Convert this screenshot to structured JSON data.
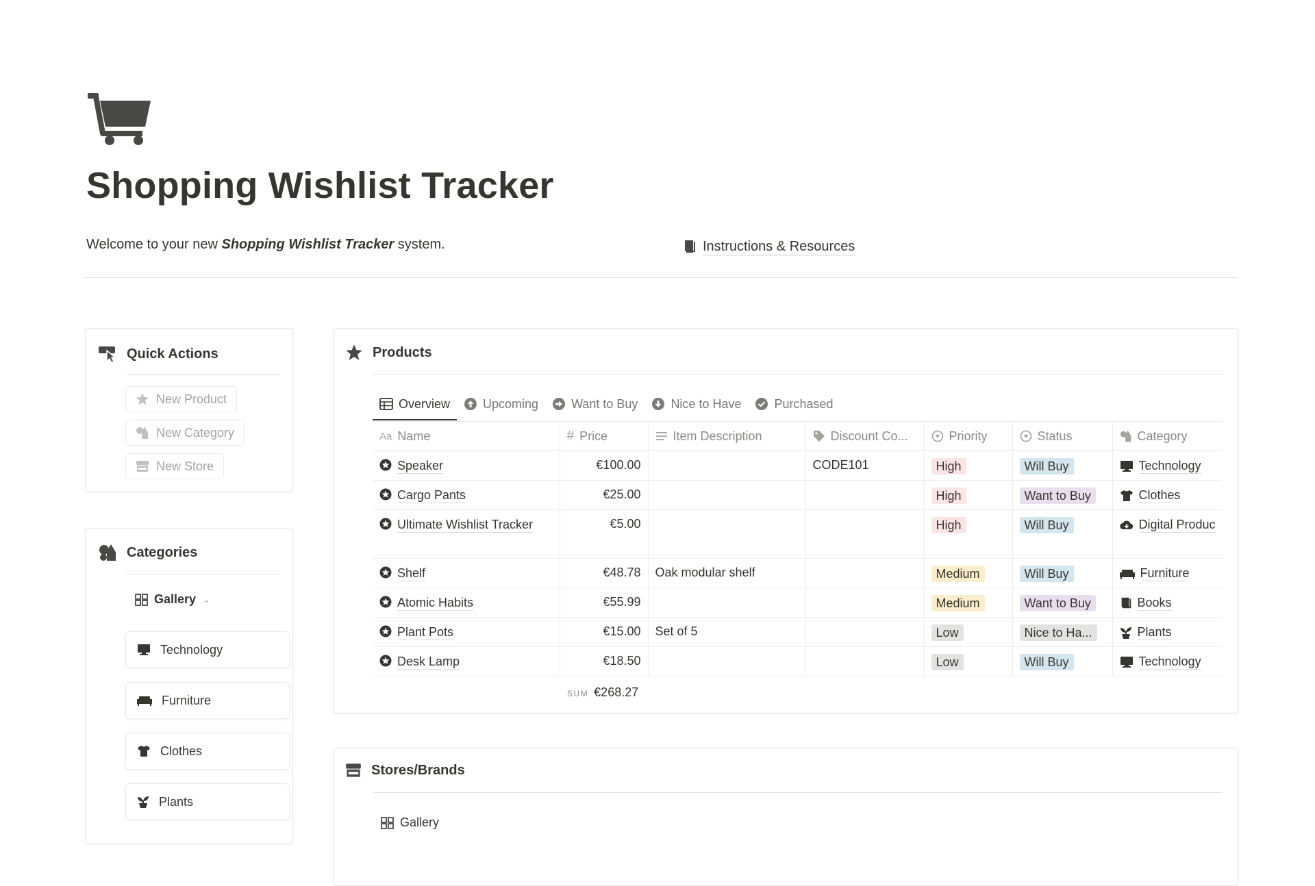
{
  "page": {
    "title": "Shopping Wishlist Tracker",
    "welcome_prefix": "Welcome to your new ",
    "welcome_em": "Shopping Wishlist Tracker",
    "welcome_suffix": " system.",
    "instructions_link": "Instructions & Resources",
    "icon": "shopping-cart-icon"
  },
  "quick_actions": {
    "title": "Quick Actions",
    "icon": "pointer-click-icon",
    "buttons": [
      {
        "label": "New Product",
        "icon": "star-icon"
      },
      {
        "label": "New Category",
        "icon": "shapes-icon"
      },
      {
        "label": "New Store",
        "icon": "store-icon"
      }
    ]
  },
  "categories": {
    "title": "Categories",
    "icon": "shapes-icon",
    "view_label": "Gallery",
    "cards": [
      {
        "label": "Technology",
        "icon": "desktop-icon"
      },
      {
        "label": "Furniture",
        "icon": "sofa-icon"
      },
      {
        "label": "Clothes",
        "icon": "tshirt-icon"
      },
      {
        "label": "Plants",
        "icon": "plant-icon"
      }
    ]
  },
  "products": {
    "title": "Products",
    "icon": "star-icon",
    "tabs": [
      {
        "label": "Overview",
        "icon": "table-icon",
        "active": true
      },
      {
        "label": "Upcoming",
        "icon": "arrow-up-circle-icon"
      },
      {
        "label": "Want to Buy",
        "icon": "arrow-right-circle-icon"
      },
      {
        "label": "Nice to Have",
        "icon": "arrow-down-circle-icon"
      },
      {
        "label": "Purchased",
        "icon": "check-circle-icon"
      }
    ],
    "columns": {
      "name": "Name",
      "price": "Price",
      "description": "Item Description",
      "discount": "Discount Co...",
      "priority": "Priority",
      "status": "Status",
      "category": "Category"
    },
    "rows": [
      {
        "name": "Speaker",
        "price": "€100.00",
        "description": "",
        "discount": "CODE101",
        "priority": "High",
        "status": "Will Buy",
        "category": "Technology"
      },
      {
        "name": "Cargo Pants",
        "price": "€25.00",
        "description": "",
        "discount": "",
        "priority": "High",
        "status": "Want to Buy",
        "category": "Clothes"
      },
      {
        "name": "Ultimate Wishlist Tracker",
        "price": "€5.00",
        "description": "",
        "discount": "",
        "priority": "High",
        "status": "Will Buy",
        "category": "Digital Produc"
      },
      {
        "name": "Shelf",
        "price": "€48.78",
        "description": "Oak modular shelf",
        "discount": "",
        "priority": "Medium",
        "status": "Will Buy",
        "category": "Furniture"
      },
      {
        "name": "Atomic Habits",
        "price": "€55.99",
        "description": "",
        "discount": "",
        "priority": "Medium",
        "status": "Want to Buy",
        "category": "Books"
      },
      {
        "name": "Plant Pots",
        "price": "€15.00",
        "description": "Set of 5",
        "discount": "",
        "priority": "Low",
        "status": "Nice to Ha...",
        "category": "Plants"
      },
      {
        "name": "Desk Lamp",
        "price": "€18.50",
        "description": "",
        "discount": "",
        "priority": "Low",
        "status": "Will Buy",
        "category": "Technology"
      }
    ],
    "sum_label": "SUM",
    "sum_value": "€268.27"
  },
  "stores": {
    "title": "Stores/Brands",
    "icon": "store-icon",
    "view_label": "Gallery"
  },
  "colors": {
    "text": "#37352f",
    "muted": "#787774",
    "tag_high_bg": "#fbe4e4",
    "tag_medium_bg": "#fbeecc",
    "tag_low_bg": "#e3e2e0",
    "tag_willbuy_bg": "#d3e5ef",
    "tag_wanttobuy_bg": "#e8deee",
    "tag_nicetohave_bg": "#e3e2e0"
  }
}
